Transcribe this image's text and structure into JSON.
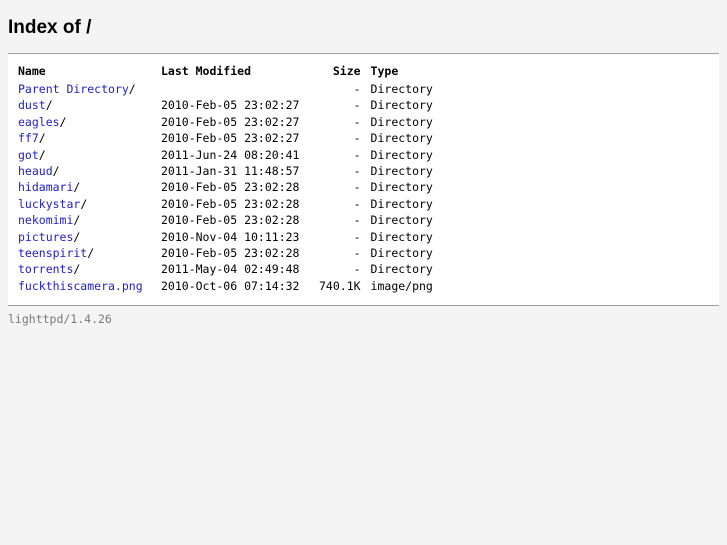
{
  "page": {
    "title": "Index of /",
    "footer": "lighttpd/1.4.26"
  },
  "table": {
    "headers": {
      "name": "Name",
      "modified": "Last Modified",
      "size": "Size",
      "type": "Type"
    },
    "rows": [
      {
        "name": "Parent Directory",
        "suffix": "/",
        "modified": "",
        "size": "-",
        "type": "Directory"
      },
      {
        "name": "dust",
        "suffix": "/",
        "modified": "2010-Feb-05 23:02:27",
        "size": "-",
        "type": "Directory"
      },
      {
        "name": "eagles",
        "suffix": "/",
        "modified": "2010-Feb-05 23:02:27",
        "size": "-",
        "type": "Directory"
      },
      {
        "name": "ff7",
        "suffix": "/",
        "modified": "2010-Feb-05 23:02:27",
        "size": "-",
        "type": "Directory"
      },
      {
        "name": "got",
        "suffix": "/",
        "modified": "2011-Jun-24 08:20:41",
        "size": "-",
        "type": "Directory"
      },
      {
        "name": "heaud",
        "suffix": "/",
        "modified": "2011-Jan-31 11:48:57",
        "size": "-",
        "type": "Directory"
      },
      {
        "name": "hidamari",
        "suffix": "/",
        "modified": "2010-Feb-05 23:02:28",
        "size": "-",
        "type": "Directory"
      },
      {
        "name": "luckystar",
        "suffix": "/",
        "modified": "2010-Feb-05 23:02:28",
        "size": "-",
        "type": "Directory"
      },
      {
        "name": "nekomimi",
        "suffix": "/",
        "modified": "2010-Feb-05 23:02:28",
        "size": "-",
        "type": "Directory"
      },
      {
        "name": "pictures",
        "suffix": "/",
        "modified": "2010-Nov-04 10:11:23",
        "size": "-",
        "type": "Directory"
      },
      {
        "name": "teenspirit",
        "suffix": "/",
        "modified": "2010-Feb-05 23:02:28",
        "size": "-",
        "type": "Directory"
      },
      {
        "name": "torrents",
        "suffix": "/",
        "modified": "2011-May-04 02:49:48",
        "size": "-",
        "type": "Directory"
      },
      {
        "name": "fuckthiscamera.png",
        "suffix": "",
        "modified": "2010-Oct-06 07:14:32",
        "size": "740.1K",
        "type": "image/png"
      }
    ]
  }
}
